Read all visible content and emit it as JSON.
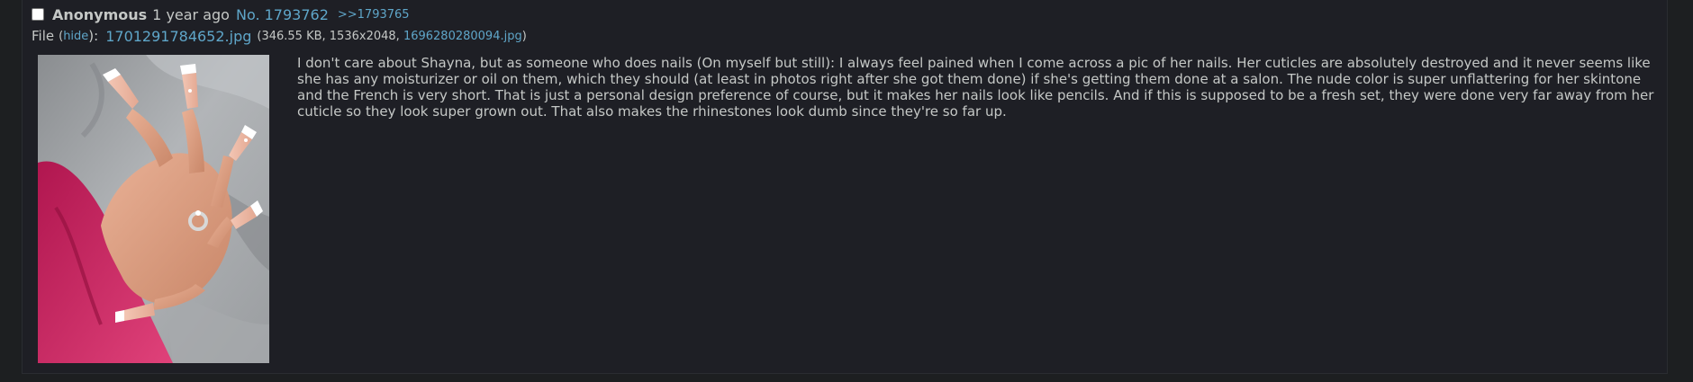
{
  "post": {
    "name": "Anonymous",
    "age": "1 year ago",
    "post_number": "No. 1793762",
    "backlinks": [
      ">>1793765"
    ]
  },
  "file": {
    "label": "File",
    "open_paren": "(",
    "hide_label": "hide",
    "close_paren_colon": "):",
    "filename": "1701291784652.jpg",
    "meta_prefix": "(346.55 KB, 1536x2048,",
    "original_name": "1696280280094.jpg",
    "meta_suffix": ")"
  },
  "body": {
    "text": "I don't care about Shayna, but as someone who does nails (On myself but still): I always feel pained when I come across a pic of her nails. Her cuticles are absolutely destroyed and it never seems like she has any moisturizer or oil on them, which they should (at least in photos right after she got them done) if she's getting them done at a salon. The nude color is super unflattering for her skintone and the French is very short. That is just a personal design preference of course, but it makes her nails look like pencils. And if this is supposed to be a fresh set, they were done very far away from her cuticle so they look super grown out. That also makes the rhinestones look dumb since they're so far up."
  },
  "colors": {
    "background": "#1e1f25",
    "text": "#c5c8c6",
    "link": "#5fa6c9"
  },
  "thumbnail": {
    "icon": "photo-of-manicured-nails"
  }
}
